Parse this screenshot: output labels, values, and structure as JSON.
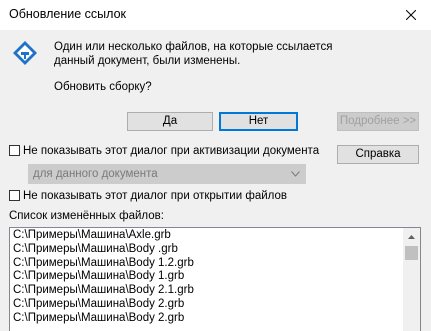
{
  "window": {
    "title": "Обновление ссылок"
  },
  "message": {
    "line1": "Один или несколько файлов, на которые ссылается",
    "line2": "данный документ, были изменены.",
    "question": "Обновить сборку?"
  },
  "buttons": {
    "yes": "Да",
    "no": "Нет",
    "details": "Подробнее >>",
    "help": "Справка"
  },
  "options": {
    "dont_show_on_activate": "Не показывать этот диалог при активизации документа",
    "scope_select_value": "для данного документа",
    "dont_show_on_open": "Не показывать этот диалог при открытии файлов"
  },
  "changed_files": {
    "label": "Список изменённых файлов:",
    "items": [
      "C:\\Примеры\\Машина\\Axle.grb",
      "C:\\Примеры\\Машина\\Body .grb",
      "C:\\Примеры\\Машина\\Body 1.2.grb",
      "C:\\Примеры\\Машина\\Body 1.grb",
      "C:\\Примеры\\Машина\\Body 2.1.grb",
      "C:\\Примеры\\Машина\\Body 2.grb",
      "C:\\Примеры\\Машина\\Body 2.grb"
    ]
  },
  "icons": {
    "app": "t-flex-logo-icon",
    "close": "close-icon",
    "dropdown": "chevron-down-icon",
    "scroll_up": "scroll-up-arrow-icon"
  },
  "colors": {
    "accent": "#0078d7",
    "logo_blue": "#1e73c8"
  }
}
